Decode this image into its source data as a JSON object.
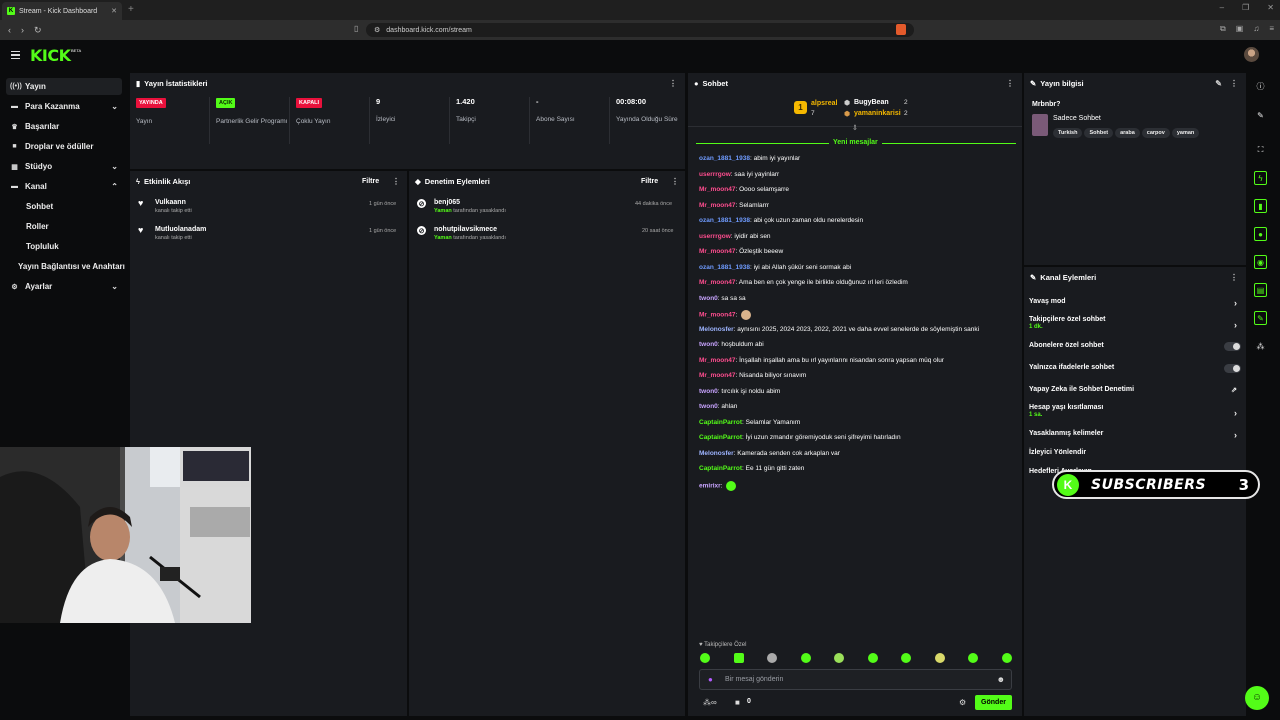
{
  "browser": {
    "tab_title": "Stream - Kick Dashboard",
    "url": "dashboard.kick.com/stream"
  },
  "header": {
    "logo": "KICK",
    "beta": "BETA"
  },
  "sidebar": {
    "items": [
      {
        "label": "Yayın"
      },
      {
        "label": "Para Kazanma"
      },
      {
        "label": "Başarılar"
      },
      {
        "label": "Droplar ve ödüller"
      },
      {
        "label": "Stüdyo"
      },
      {
        "label": "Kanal"
      },
      {
        "label": "Sohbet"
      },
      {
        "label": "Roller"
      },
      {
        "label": "Topluluk"
      },
      {
        "label": "Yayın Bağlantısı ve Anahtarı"
      },
      {
        "label": "Ayarlar"
      }
    ]
  },
  "stats": {
    "title": "Yayın İstatistikleri",
    "cols": [
      {
        "badge": "YAYINDA",
        "label": "Yayın"
      },
      {
        "badge": "AÇIK",
        "label": "Partnerlik Gelir Programı"
      },
      {
        "badge": "KAPALI",
        "label": "Çoklu Yayın"
      },
      {
        "value": "9",
        "label": "İzleyici"
      },
      {
        "value": "1.420",
        "label": "Takipçi"
      },
      {
        "value": "-",
        "label": "Abone Sayısı"
      },
      {
        "value": "00:08:00",
        "label": "Yayında Olduğu Süre"
      }
    ]
  },
  "activity": {
    "title": "Etkinlik Akışı",
    "filter": "Filtre",
    "items": [
      {
        "name": "Vulkaann",
        "desc": "kanalı takip etti",
        "time": "1 gün önce"
      },
      {
        "name": "Mutluolanadam",
        "desc": "kanalı takip etti",
        "time": "1 gün önce"
      }
    ]
  },
  "moderation": {
    "title": "Denetim Eylemleri",
    "filter": "Filtre",
    "items": [
      {
        "name": "benj065",
        "actor": "Yaman",
        "desc": "tarafından yasaklandı",
        "time": "44 dakika önce"
      },
      {
        "name": "nohutpilavsikmece",
        "actor": "Yaman",
        "desc": "tarafından yasaklandı",
        "time": "20 saat önce"
      }
    ]
  },
  "chat": {
    "title": "Sohbet",
    "top": [
      {
        "name": "alpsreal",
        "count": "7"
      },
      {
        "name": "BugyBean",
        "count": "2"
      },
      {
        "name": "yamaninkarisi",
        "count": "2"
      }
    ],
    "new_messages": "Yeni mesajlar",
    "messages": [
      {
        "user": "ozan_1881_1938",
        "text": "abim iyi yayınlar",
        "color": "#6f9bff"
      },
      {
        "user": "userrrgow",
        "text": "saa iyi yayinlarr",
        "color": "#ff4d8f"
      },
      {
        "user": "Mr_moon47",
        "text": "Oooo selamşarre",
        "color": "#ff4d8f"
      },
      {
        "user": "Mr_moon47",
        "text": "Selamlarrr",
        "color": "#ff4d8f"
      },
      {
        "user": "ozan_1881_1938",
        "text": "abi çok uzun zaman oldu nerelerdesin",
        "color": "#6f9bff"
      },
      {
        "user": "userrrgow",
        "text": "iyidir abi sen",
        "color": "#ff4d8f"
      },
      {
        "user": "Mr_moon47",
        "text": "Özleştik beeew",
        "color": "#ff4d8f"
      },
      {
        "user": "ozan_1881_1938",
        "text": "iyi abi Allah şükür seni sormak abi",
        "color": "#6f9bff"
      },
      {
        "user": "Mr_moon47",
        "text": "Ama ben en çok yenge ile birlikte olduğunuz ırl leri özledim",
        "color": "#ff4d8f"
      },
      {
        "user": "twon0",
        "text": "sa sa sa",
        "color": "#c8a4ff"
      },
      {
        "user": "Mr_moon47",
        "text": "",
        "color": "#ff4d8f"
      },
      {
        "user": "Melonosfer",
        "text": "aynısını 2025, 2024 2023, 2022, 2021 ve daha evvel senelerde de söylemiştin sanki",
        "color": "#9db4ff"
      },
      {
        "user": "twon0",
        "text": "hoşbuldum abi",
        "color": "#c8a4ff"
      },
      {
        "user": "Mr_moon47",
        "text": "İnşallah inşallah ama bu ırl yayınlarını nisandan sonra yapsan müq olur",
        "color": "#ff4d8f"
      },
      {
        "user": "Mr_moon47",
        "text": "Nisanda biliyor sınavım",
        "color": "#ff4d8f"
      },
      {
        "user": "twon0",
        "text": "tırcılık işi noldu abim",
        "color": "#c8a4ff"
      },
      {
        "user": "twon0",
        "text": "ahlan",
        "color": "#c8a4ff"
      },
      {
        "user": "CaptainParrot",
        "text": "Selamlar Yamanım",
        "color": "#53fc18"
      },
      {
        "user": "CaptainParrot",
        "text": "İyi uzun zmandır göremiyoduk seni şifreyimi hatırladın",
        "color": "#53fc18"
      },
      {
        "user": "Melonosfer",
        "text": "Kamerada senden cok arkaplan var",
        "color": "#9db4ff"
      },
      {
        "user": "CaptainParrot",
        "text": "Ee 11 gün gitti zaten",
        "color": "#53fc18"
      },
      {
        "user": "emirixr",
        "text": "",
        "color": "#c8a4ff"
      }
    ],
    "followers_only": "Takipçilere Özel",
    "placeholder": "Bir mesaj gönderin",
    "send": "Gönder",
    "points": "0"
  },
  "stream_info": {
    "title": "Yayın bilgisi",
    "stream_title": "Mrbnbr?",
    "category": "Sadece Sohbet",
    "tags": [
      "Turkish",
      "Sohbet",
      "araba",
      "carpov",
      "yaman"
    ]
  },
  "channel_actions": {
    "title": "Kanal Eylemleri",
    "items": [
      {
        "label": "Yavaş mod"
      },
      {
        "label": "Takipçilere özel sohbet",
        "sub": "1 dk."
      },
      {
        "label": "Abonelere özel sohbet"
      },
      {
        "label": "Yalnızca ifadelerle sohbet"
      },
      {
        "label": "Yapay Zeka ile Sohbet Denetimi"
      },
      {
        "label": "Hesap yaşı kısıtlaması",
        "sub": "1 sa."
      },
      {
        "label": "Yasaklanmış kelimeler"
      },
      {
        "label": "İzleyici Yönlendir"
      },
      {
        "label": "Hedefleri Ayarlayın"
      }
    ]
  },
  "overlay": {
    "subs_label": "SUBSCRIBERS",
    "subs_count": "3"
  },
  "colors": {
    "accent": "#53fc18",
    "live": "#e9113c",
    "panel": "#191b1f",
    "bg": "#0b0c0d"
  }
}
